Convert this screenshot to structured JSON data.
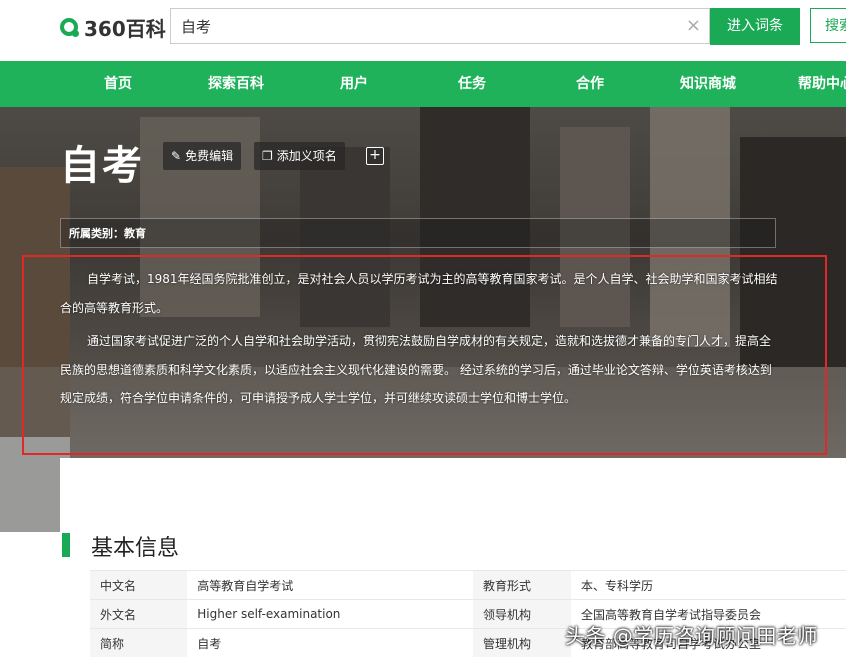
{
  "header": {
    "logo_text": "360百科",
    "search_value": "自考",
    "clear_icon": "×",
    "enter_label": "进入词条",
    "search_label": "搜索"
  },
  "nav": {
    "items": [
      "首页",
      "探索百科",
      "用户",
      "任务",
      "合作",
      "知识商城",
      "帮助中心"
    ]
  },
  "entry": {
    "title": "自考",
    "edit_label": "免费编辑",
    "add_meaning_label": "添加义项名",
    "plus_icon": "+",
    "category": "所属类别：教育",
    "paragraphs": [
      "自学考试，1981年经国务院批准创立，是对社会人员以学历考试为主的高等教育国家考试。是个人自学、社会助学和国家考试相结合的高等教育形式。",
      "通过国家考试促进广泛的个人自学和社会助学活动，贯彻宪法鼓励自学成材的有关规定，造就和选拔德才兼备的专门人才，提高全民族的思想道德素质和科学文化素质，以适应社会主义现代化建设的需要。 经过系统的学习后，通过毕业论文答辩、学位英语考核达到规定成绩，符合学位申请条件的，可申请授予成人学士学位，并可继续攻读硕士学位和博士学位。"
    ]
  },
  "basic_info": {
    "title": "基本信息",
    "rows": [
      {
        "k1": "中文名",
        "v1": "高等教育自学考试",
        "k2": "教育形式",
        "v2": "本、专科学历"
      },
      {
        "k1": "外文名",
        "v1": "Higher self-examination",
        "k2": "领导机构",
        "v2": "全国高等教育自学考试指导委员会"
      },
      {
        "k1": "简称",
        "v1": "自考",
        "k2": "管理机构",
        "v2": "教育部高等教育司自学考试办公室"
      }
    ]
  },
  "watermark": "头条 @学历咨询顾问田老师",
  "colors": {
    "brand_green": "#1aaa55",
    "nav_green": "#1fb25a",
    "highlight_red": "#e02828"
  }
}
